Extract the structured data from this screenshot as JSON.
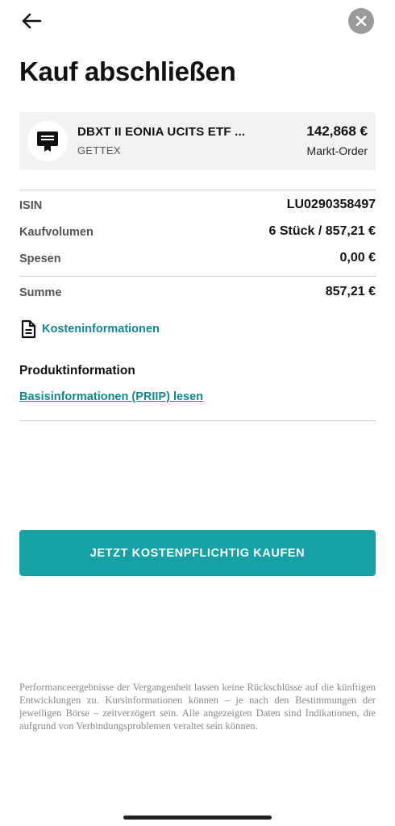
{
  "header": {
    "back_icon": "arrow-left-icon",
    "close_icon": "close-circle-icon"
  },
  "page_title": "Kauf abschließen",
  "product": {
    "icon": "certificate-icon",
    "name": "DBXT II EONIA UCITS ETF ...",
    "exchange": "GETTEX",
    "price": "142,868 €",
    "order_type": "Markt-Order"
  },
  "details": {
    "isin_label": "ISIN",
    "isin_value": "LU0290358497",
    "volume_label": "Kaufvolumen",
    "volume_value": "6 Stück / 857,21 €",
    "fees_label": "Spesen",
    "fees_value": "0,00 €",
    "total_label": "Summe",
    "total_value": "857,21 €"
  },
  "cost_info": {
    "icon": "document-icon",
    "label": "Kosteninformationen"
  },
  "product_info": {
    "heading": "Produktinformation",
    "link_label": "Basisinformationen (PRIIP) lesen"
  },
  "buy_button": {
    "label": "JETZT KOSTENPFLICHTIG KAUFEN"
  },
  "disclaimer": "Performanceergebnisse der Vergangenheit lassen keine Rückschlüsse auf die künftigen Entwicklungen zu. Kursinformationen können – je nach den Bestimmungen der jeweiligen Börse – zeitverzögert sein. Alle angezeigten Daten sind Indikationen, die aufgrund von Verbindungsproblemen veraltet sein können.",
  "colors": {
    "accent": "#17a0a6",
    "link": "#11898f",
    "card_background": "#f2f2f2",
    "close_button": "#9a9a9a"
  }
}
